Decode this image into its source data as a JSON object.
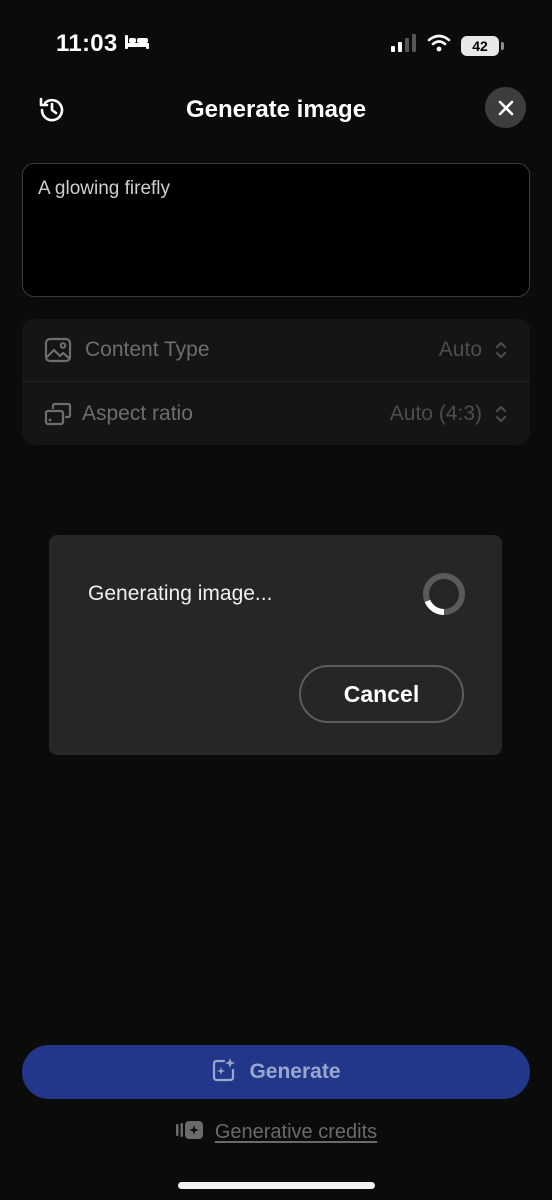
{
  "status_bar": {
    "time": "11:03",
    "focus_icon": "bed-icon",
    "battery_level": "42"
  },
  "header": {
    "title": "Generate image",
    "history_icon": "history-icon",
    "close_icon": "close-icon"
  },
  "prompt": {
    "text": "A glowing firefly"
  },
  "settings": [
    {
      "label": "Content Type",
      "value": "Auto",
      "icon": "image-icon"
    },
    {
      "label": "Aspect ratio",
      "value": "Auto (4:3)",
      "icon": "aspect-ratio-icon"
    }
  ],
  "dialog": {
    "message": "Generating image...",
    "cancel_label": "Cancel"
  },
  "generate": {
    "label": "Generate",
    "icon": "sparkle-image-icon"
  },
  "credits": {
    "label": "Generative credits",
    "icon": "credits-icon"
  },
  "colors": {
    "background": "#0b0b0b",
    "generate_button": "#22378a",
    "dialog_bg": "#262626"
  }
}
